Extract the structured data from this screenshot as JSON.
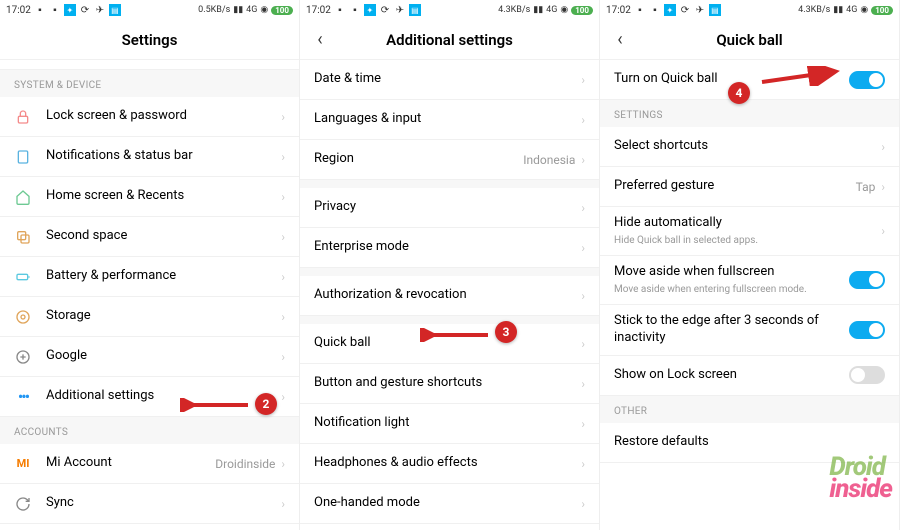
{
  "status": {
    "time": "17:02",
    "net3": "4.3KB/s",
    "net1": "0.5KB/s",
    "sig": "4G",
    "battery": "100"
  },
  "screen1": {
    "title": "Settings",
    "section_system": "SYSTEM & DEVICE",
    "section_accounts": "ACCOUNTS",
    "items": {
      "lock": "Lock screen & password",
      "notif": "Notifications & status bar",
      "home": "Home screen & Recents",
      "second": "Second space",
      "battery": "Battery & performance",
      "storage": "Storage",
      "google": "Google",
      "additional": "Additional settings",
      "miaccount": "Mi Account",
      "miaccount_val": "Droidinside",
      "sync": "Sync"
    }
  },
  "screen2": {
    "title": "Additional settings",
    "items": {
      "date": "Date & time",
      "lang": "Languages & input",
      "region": "Region",
      "region_val": "Indonesia",
      "privacy": "Privacy",
      "enterprise": "Enterprise mode",
      "auth": "Authorization & revocation",
      "quickball": "Quick ball",
      "buttons": "Button and gesture shortcuts",
      "notiflight": "Notification light",
      "headphones": "Headphones & audio effects",
      "onehanded": "One-handed mode"
    }
  },
  "screen3": {
    "title": "Quick ball",
    "section_settings": "SETTINGS",
    "section_other": "OTHER",
    "items": {
      "turnon": "Turn on Quick ball",
      "shortcuts": "Select shortcuts",
      "gesture": "Preferred gesture",
      "gesture_val": "Tap",
      "hide": "Hide automatically",
      "hide_sub": "Hide Quick ball in selected apps.",
      "moveaside": "Move aside when fullscreen",
      "moveaside_sub": "Move aside when entering fullscreen mode.",
      "stick": "Stick to the edge after 3 seconds of inactivity",
      "lockscreen": "Show on Lock screen",
      "restore": "Restore defaults"
    }
  },
  "annotations": {
    "b2": "2",
    "b3": "3",
    "b4": "4"
  },
  "watermark": {
    "line1": "Droid",
    "line2": "inside"
  }
}
